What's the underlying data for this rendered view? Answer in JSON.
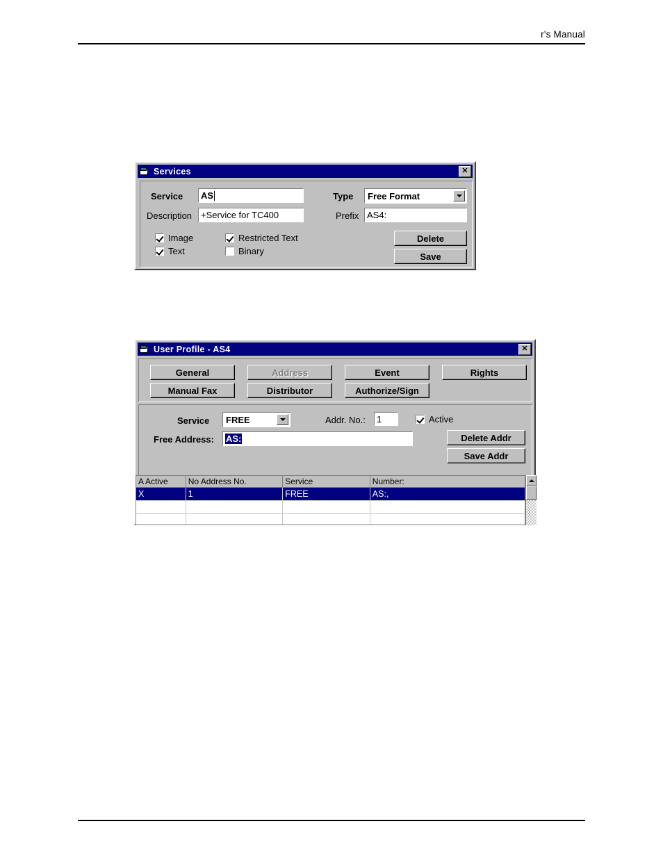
{
  "page": {
    "header_text": "r's Manual"
  },
  "services_dialog": {
    "title": "Services",
    "icon": "app-window-icon",
    "close_label": "✕",
    "service_label": "Service",
    "service_value": "AS",
    "description_label": "Description",
    "description_value": "+Service for TC400",
    "type_label": "Type",
    "type_value": "Free Format",
    "prefix_label": "Prefix",
    "prefix_value": "AS4:",
    "checkboxes": [
      {
        "label": "Image",
        "checked": true
      },
      {
        "label": "Text",
        "checked": true
      },
      {
        "label": "Restricted Text",
        "checked": true
      },
      {
        "label": "Binary",
        "checked": false
      }
    ],
    "delete_label": "Delete",
    "save_label": "Save"
  },
  "user_profile_dialog": {
    "title": "User Profile - AS4",
    "icon": "app-window-icon",
    "close_label": "✕",
    "nav_buttons": [
      {
        "label": "General",
        "disabled": false
      },
      {
        "label": "Address",
        "disabled": true
      },
      {
        "label": "Event",
        "disabled": false
      },
      {
        "label": "Rights",
        "disabled": false
      },
      {
        "label": "Manual Fax",
        "disabled": false
      },
      {
        "label": "Distributor",
        "disabled": false
      },
      {
        "label": "Authorize/Sign",
        "disabled": false
      }
    ],
    "service_label": "Service",
    "service_value": "FREE",
    "addr_no_label": "Addr. No.:",
    "addr_no_value": "1",
    "active_label": "Active",
    "active_checked": true,
    "free_address_label": "Free Address:",
    "free_address_value": "AS:",
    "delete_addr_label": "Delete Addr",
    "save_addr_label": "Save Addr",
    "grid": {
      "columns": [
        "A Active",
        "No Address No.",
        "Service",
        "Number:"
      ],
      "rows": [
        {
          "cells": [
            "X",
            "1",
            "FREE",
            "AS:,"
          ],
          "selected": true
        },
        {
          "cells": [
            "",
            "",
            "",
            ""
          ],
          "selected": false
        },
        {
          "cells": [
            "",
            "",
            "",
            ""
          ],
          "selected": false
        }
      ]
    }
  },
  "colors": {
    "titlebar": "#000080",
    "face": "#c0c0c0",
    "selection": "#000080"
  }
}
